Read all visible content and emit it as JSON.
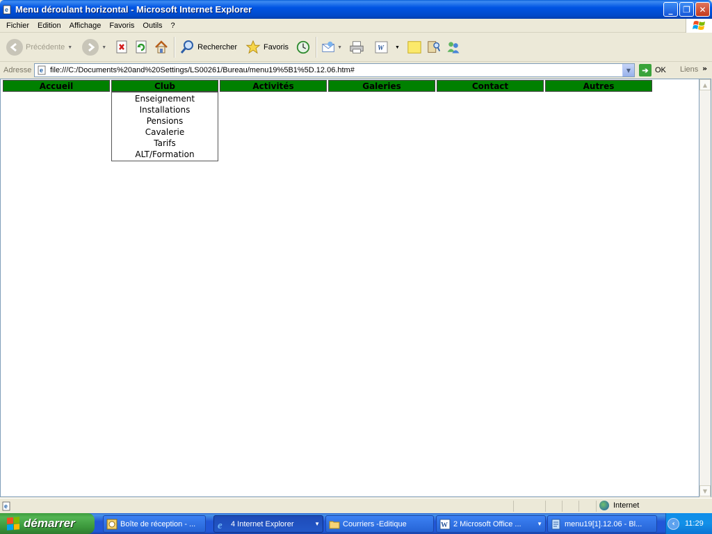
{
  "window": {
    "title": "Menu déroulant horizontal - Microsoft Internet Explorer",
    "minimize": "_",
    "maximize": "❐",
    "close": "✕"
  },
  "menubar": {
    "items": [
      "Fichier",
      "Edition",
      "Affichage",
      "Favoris",
      "Outils",
      "?"
    ]
  },
  "toolbar": {
    "back_label": "Précédente",
    "search_label": "Rechercher",
    "favorites_label": "Favoris"
  },
  "address": {
    "label": "Adresse",
    "url": "file:///C:/Documents%20and%20Settings/LS00261/Bureau/menu19%5B1%5D.12.06.htm#",
    "go_label": "OK",
    "links_label": "Liens"
  },
  "page": {
    "nav": [
      "Accueil",
      "Club",
      "Activités",
      "Galeries",
      "Contact",
      "Autres"
    ],
    "dropdown": [
      "Enseignement",
      "Installations",
      "Pensions",
      "Cavalerie",
      "Tarifs",
      "ALT/Formation"
    ],
    "nav_color": "#008000"
  },
  "statusbar": {
    "zone": "Internet"
  },
  "taskbar": {
    "start_label": "démarrer",
    "tasks": [
      "Boîte de réception - ...",
      "4 Internet Explorer",
      "Courriers -Editique",
      "2 Microsoft Office ...",
      "menu19[1].12.06 - Bl..."
    ],
    "clock": "11:29"
  }
}
